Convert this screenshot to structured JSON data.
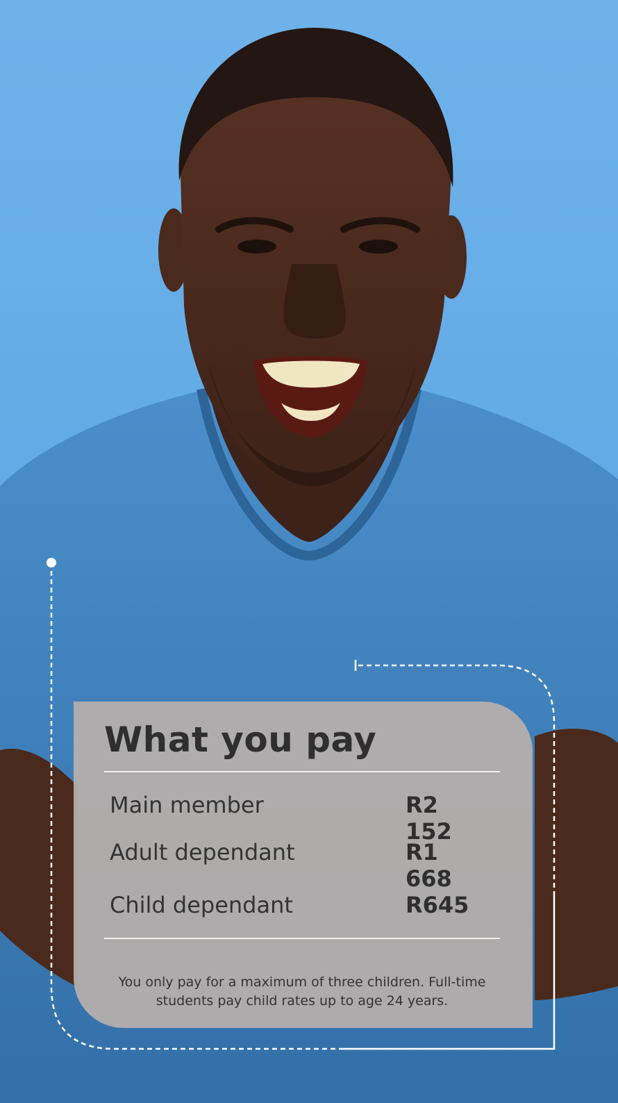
{
  "card": {
    "title": "What you pay",
    "rows": [
      {
        "label": "Main member",
        "amount": "R2 152"
      },
      {
        "label": "Adult dependant",
        "amount": "R1 668"
      },
      {
        "label": "Child dependant",
        "amount": "R645"
      }
    ],
    "note": "You only pay for a maximum of three children. Full-time students pay child rates up to age 24 years."
  },
  "colors": {
    "background": "#63abe6",
    "shirt": "#3f86c4",
    "card": "#b7b0aa",
    "text": "#2f2f2f",
    "dashed_line": "#ffffff"
  }
}
